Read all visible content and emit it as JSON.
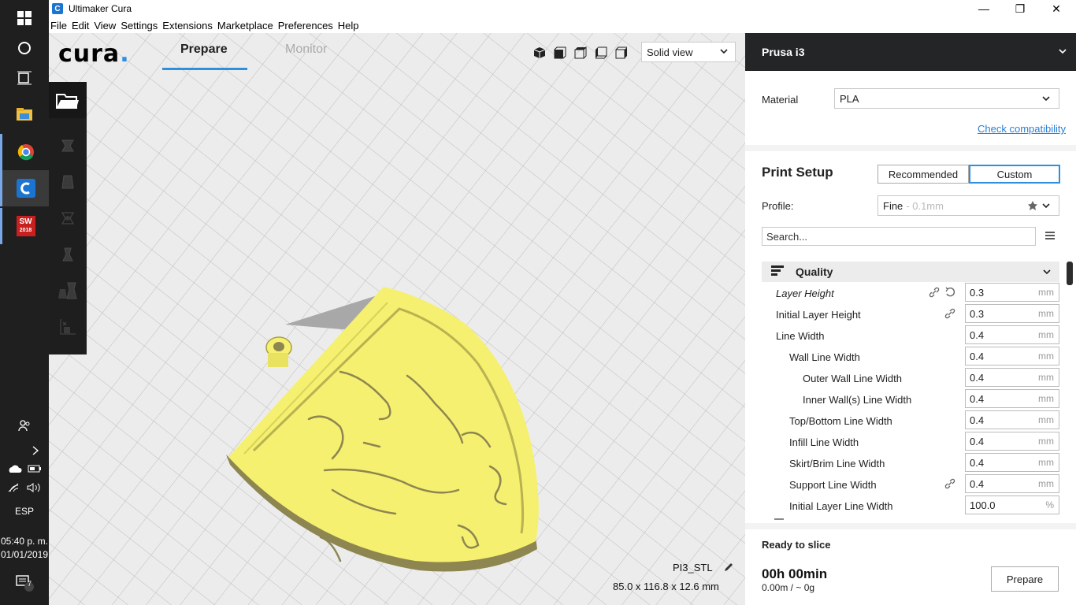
{
  "window": {
    "title": "Ultimaker Cura",
    "app_icon_letter": "C",
    "controls": {
      "minimize": "—",
      "maximize": "❐",
      "close": "✕"
    }
  },
  "menubar": [
    "File",
    "Edit",
    "View",
    "Settings",
    "Extensions",
    "Marketplace",
    "Preferences",
    "Help"
  ],
  "header": {
    "logo": "cura",
    "logo_dot": ".",
    "tabs": [
      "Prepare",
      "Monitor"
    ],
    "active_tab": "Prepare",
    "view_mode": "Solid view"
  },
  "taskbar": {
    "language": "ESP",
    "time": "05:40 p. m.",
    "date": "01/01/2019",
    "notification_count": "7",
    "solidworks_label": "SW",
    "solidworks_year": "2018"
  },
  "model": {
    "name": "PI3_STL",
    "dimensions": "85.0 x 116.8 x 12.6 mm",
    "color": "#f5f070"
  },
  "panel": {
    "printer": "Prusa i3",
    "material_label": "Material",
    "material_value": "PLA",
    "check_compat": "Check compatibility",
    "print_setup_title": "Print Setup",
    "modes": [
      "Recommended",
      "Custom"
    ],
    "active_mode": "Custom",
    "profile_label": "Profile:",
    "profile_value": "Fine",
    "profile_hint": "- 0.1mm",
    "search_placeholder": "Search...",
    "category": "Quality",
    "settings": [
      {
        "label": "Layer Height",
        "value": "0.3",
        "unit": "mm",
        "italic": true,
        "link": true,
        "reset": true
      },
      {
        "label": "Initial Layer Height",
        "value": "0.3",
        "unit": "mm",
        "link": true
      },
      {
        "label": "Line Width",
        "value": "0.4",
        "unit": "mm"
      },
      {
        "label": "Wall Line Width",
        "value": "0.4",
        "unit": "mm"
      },
      {
        "label": "Outer Wall Line Width",
        "value": "0.4",
        "unit": "mm"
      },
      {
        "label": "Inner Wall(s) Line Width",
        "value": "0.4",
        "unit": "mm"
      },
      {
        "label": "Top/Bottom Line Width",
        "value": "0.4",
        "unit": "mm"
      },
      {
        "label": "Infill Line Width",
        "value": "0.4",
        "unit": "mm"
      },
      {
        "label": "Skirt/Brim Line Width",
        "value": "0.4",
        "unit": "mm"
      },
      {
        "label": "Support Line Width",
        "value": "0.4",
        "unit": "mm",
        "link": true
      },
      {
        "label": "Initial Layer Line Width",
        "value": "100.0",
        "unit": "%"
      }
    ],
    "ready_text": "Ready to slice",
    "time_estimate": "00h 00min",
    "usage": "0.00m / ~ 0g",
    "prepare_button": "Prepare"
  },
  "colors": {
    "accent": "#2c8fdf",
    "dark_bar": "#232527",
    "link": "#2a7fd6"
  }
}
